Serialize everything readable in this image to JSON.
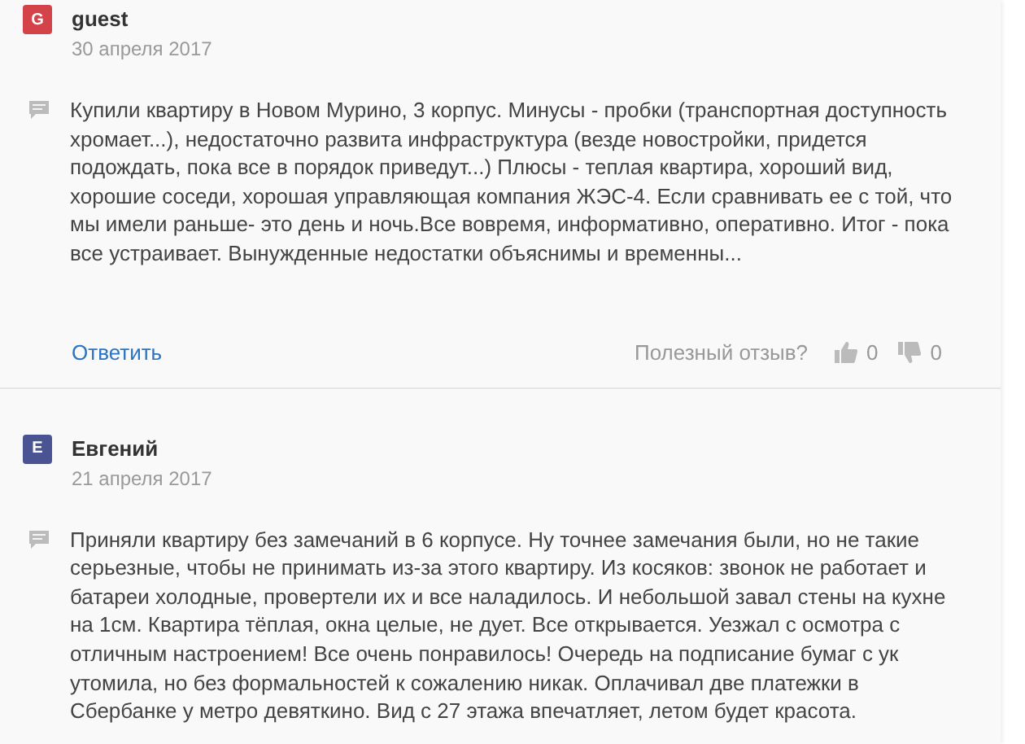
{
  "reviews": [
    {
      "avatar": "G",
      "color": "#d4424a",
      "name": "guest",
      "date": "30 апреля 2017",
      "text": "Купили квартиру в Новом Мурино, 3 корпус. Минусы - пробки (транспортная доступность хромает...), недостаточно развита инфраструктура (везде новостройки, придется подождать, пока все в порядок приведут...) Плюсы - теплая квартира, хороший вид, хорошие соседи, хорошая управляющая компания ЖЭС-4. Если сравнивать ее с той, что мы имели раньше- это день и ночь.Все вовремя, информативно, оперативно. Итог - пока все устраивает. Вынужденные недостатки объяснимы и временны...",
      "footer": {
        "reply": "Ответить",
        "helpful": "Полезный отзыв?",
        "likes": "0",
        "dislikes": "0"
      }
    },
    {
      "avatar": "E",
      "color": "#4a5492",
      "name": "Евгений",
      "date": "21 апреля 2017",
      "text": "Приняли квартиру без замечаний в 6 корпусе. Ну точнее замечания были, но не такие серьезные, чтобы не принимать из-за этого квартиру. Из косяков: звонок не работает и батареи холодные, провертели их и все наладилось. И небольшой завал стены на кухне на 1см. Квартира тёплая, окна целые, не дует. Все открывается. Уезжал с осмотра с отличным настроением! Все очень понравилось! Очередь на подписание бумаг с ук утомила, но без формальностей к сожалению никак. Оплачивал две платежки в Сбербанке у метро девяткино. Вид с 27 этажа впечатляет, летом будет красота."
    }
  ]
}
